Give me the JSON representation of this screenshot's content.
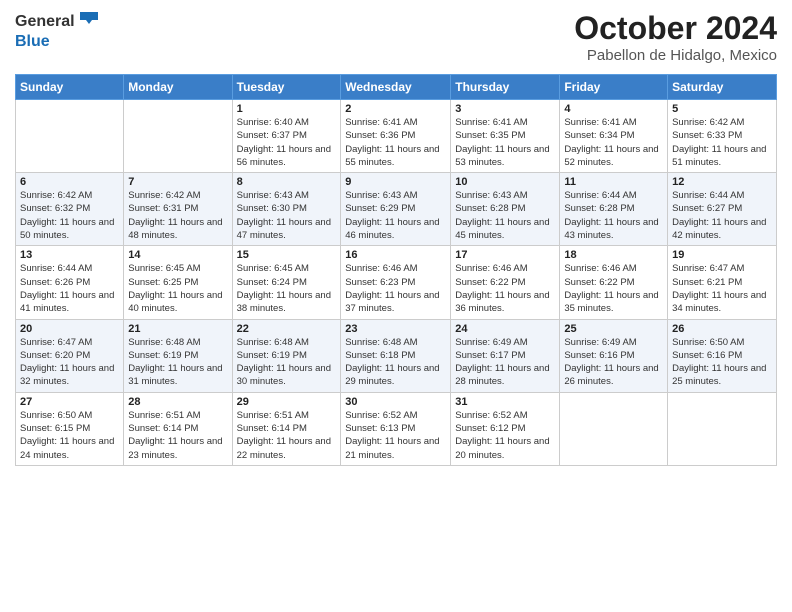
{
  "logo": {
    "general": "General",
    "blue": "Blue"
  },
  "title": "October 2024",
  "subtitle": "Pabellon de Hidalgo, Mexico",
  "days_of_week": [
    "Sunday",
    "Monday",
    "Tuesday",
    "Wednesday",
    "Thursday",
    "Friday",
    "Saturday"
  ],
  "weeks": [
    [
      {
        "day": "",
        "sunrise": "",
        "sunset": "",
        "daylight": ""
      },
      {
        "day": "",
        "sunrise": "",
        "sunset": "",
        "daylight": ""
      },
      {
        "day": "1",
        "sunrise": "Sunrise: 6:40 AM",
        "sunset": "Sunset: 6:37 PM",
        "daylight": "Daylight: 11 hours and 56 minutes."
      },
      {
        "day": "2",
        "sunrise": "Sunrise: 6:41 AM",
        "sunset": "Sunset: 6:36 PM",
        "daylight": "Daylight: 11 hours and 55 minutes."
      },
      {
        "day": "3",
        "sunrise": "Sunrise: 6:41 AM",
        "sunset": "Sunset: 6:35 PM",
        "daylight": "Daylight: 11 hours and 53 minutes."
      },
      {
        "day": "4",
        "sunrise": "Sunrise: 6:41 AM",
        "sunset": "Sunset: 6:34 PM",
        "daylight": "Daylight: 11 hours and 52 minutes."
      },
      {
        "day": "5",
        "sunrise": "Sunrise: 6:42 AM",
        "sunset": "Sunset: 6:33 PM",
        "daylight": "Daylight: 11 hours and 51 minutes."
      }
    ],
    [
      {
        "day": "6",
        "sunrise": "Sunrise: 6:42 AM",
        "sunset": "Sunset: 6:32 PM",
        "daylight": "Daylight: 11 hours and 50 minutes."
      },
      {
        "day": "7",
        "sunrise": "Sunrise: 6:42 AM",
        "sunset": "Sunset: 6:31 PM",
        "daylight": "Daylight: 11 hours and 48 minutes."
      },
      {
        "day": "8",
        "sunrise": "Sunrise: 6:43 AM",
        "sunset": "Sunset: 6:30 PM",
        "daylight": "Daylight: 11 hours and 47 minutes."
      },
      {
        "day": "9",
        "sunrise": "Sunrise: 6:43 AM",
        "sunset": "Sunset: 6:29 PM",
        "daylight": "Daylight: 11 hours and 46 minutes."
      },
      {
        "day": "10",
        "sunrise": "Sunrise: 6:43 AM",
        "sunset": "Sunset: 6:28 PM",
        "daylight": "Daylight: 11 hours and 45 minutes."
      },
      {
        "day": "11",
        "sunrise": "Sunrise: 6:44 AM",
        "sunset": "Sunset: 6:28 PM",
        "daylight": "Daylight: 11 hours and 43 minutes."
      },
      {
        "day": "12",
        "sunrise": "Sunrise: 6:44 AM",
        "sunset": "Sunset: 6:27 PM",
        "daylight": "Daylight: 11 hours and 42 minutes."
      }
    ],
    [
      {
        "day": "13",
        "sunrise": "Sunrise: 6:44 AM",
        "sunset": "Sunset: 6:26 PM",
        "daylight": "Daylight: 11 hours and 41 minutes."
      },
      {
        "day": "14",
        "sunrise": "Sunrise: 6:45 AM",
        "sunset": "Sunset: 6:25 PM",
        "daylight": "Daylight: 11 hours and 40 minutes."
      },
      {
        "day": "15",
        "sunrise": "Sunrise: 6:45 AM",
        "sunset": "Sunset: 6:24 PM",
        "daylight": "Daylight: 11 hours and 38 minutes."
      },
      {
        "day": "16",
        "sunrise": "Sunrise: 6:46 AM",
        "sunset": "Sunset: 6:23 PM",
        "daylight": "Daylight: 11 hours and 37 minutes."
      },
      {
        "day": "17",
        "sunrise": "Sunrise: 6:46 AM",
        "sunset": "Sunset: 6:22 PM",
        "daylight": "Daylight: 11 hours and 36 minutes."
      },
      {
        "day": "18",
        "sunrise": "Sunrise: 6:46 AM",
        "sunset": "Sunset: 6:22 PM",
        "daylight": "Daylight: 11 hours and 35 minutes."
      },
      {
        "day": "19",
        "sunrise": "Sunrise: 6:47 AM",
        "sunset": "Sunset: 6:21 PM",
        "daylight": "Daylight: 11 hours and 34 minutes."
      }
    ],
    [
      {
        "day": "20",
        "sunrise": "Sunrise: 6:47 AM",
        "sunset": "Sunset: 6:20 PM",
        "daylight": "Daylight: 11 hours and 32 minutes."
      },
      {
        "day": "21",
        "sunrise": "Sunrise: 6:48 AM",
        "sunset": "Sunset: 6:19 PM",
        "daylight": "Daylight: 11 hours and 31 minutes."
      },
      {
        "day": "22",
        "sunrise": "Sunrise: 6:48 AM",
        "sunset": "Sunset: 6:19 PM",
        "daylight": "Daylight: 11 hours and 30 minutes."
      },
      {
        "day": "23",
        "sunrise": "Sunrise: 6:48 AM",
        "sunset": "Sunset: 6:18 PM",
        "daylight": "Daylight: 11 hours and 29 minutes."
      },
      {
        "day": "24",
        "sunrise": "Sunrise: 6:49 AM",
        "sunset": "Sunset: 6:17 PM",
        "daylight": "Daylight: 11 hours and 28 minutes."
      },
      {
        "day": "25",
        "sunrise": "Sunrise: 6:49 AM",
        "sunset": "Sunset: 6:16 PM",
        "daylight": "Daylight: 11 hours and 26 minutes."
      },
      {
        "day": "26",
        "sunrise": "Sunrise: 6:50 AM",
        "sunset": "Sunset: 6:16 PM",
        "daylight": "Daylight: 11 hours and 25 minutes."
      }
    ],
    [
      {
        "day": "27",
        "sunrise": "Sunrise: 6:50 AM",
        "sunset": "Sunset: 6:15 PM",
        "daylight": "Daylight: 11 hours and 24 minutes."
      },
      {
        "day": "28",
        "sunrise": "Sunrise: 6:51 AM",
        "sunset": "Sunset: 6:14 PM",
        "daylight": "Daylight: 11 hours and 23 minutes."
      },
      {
        "day": "29",
        "sunrise": "Sunrise: 6:51 AM",
        "sunset": "Sunset: 6:14 PM",
        "daylight": "Daylight: 11 hours and 22 minutes."
      },
      {
        "day": "30",
        "sunrise": "Sunrise: 6:52 AM",
        "sunset": "Sunset: 6:13 PM",
        "daylight": "Daylight: 11 hours and 21 minutes."
      },
      {
        "day": "31",
        "sunrise": "Sunrise: 6:52 AM",
        "sunset": "Sunset: 6:12 PM",
        "daylight": "Daylight: 11 hours and 20 minutes."
      },
      {
        "day": "",
        "sunrise": "",
        "sunset": "",
        "daylight": ""
      },
      {
        "day": "",
        "sunrise": "",
        "sunset": "",
        "daylight": ""
      }
    ]
  ]
}
